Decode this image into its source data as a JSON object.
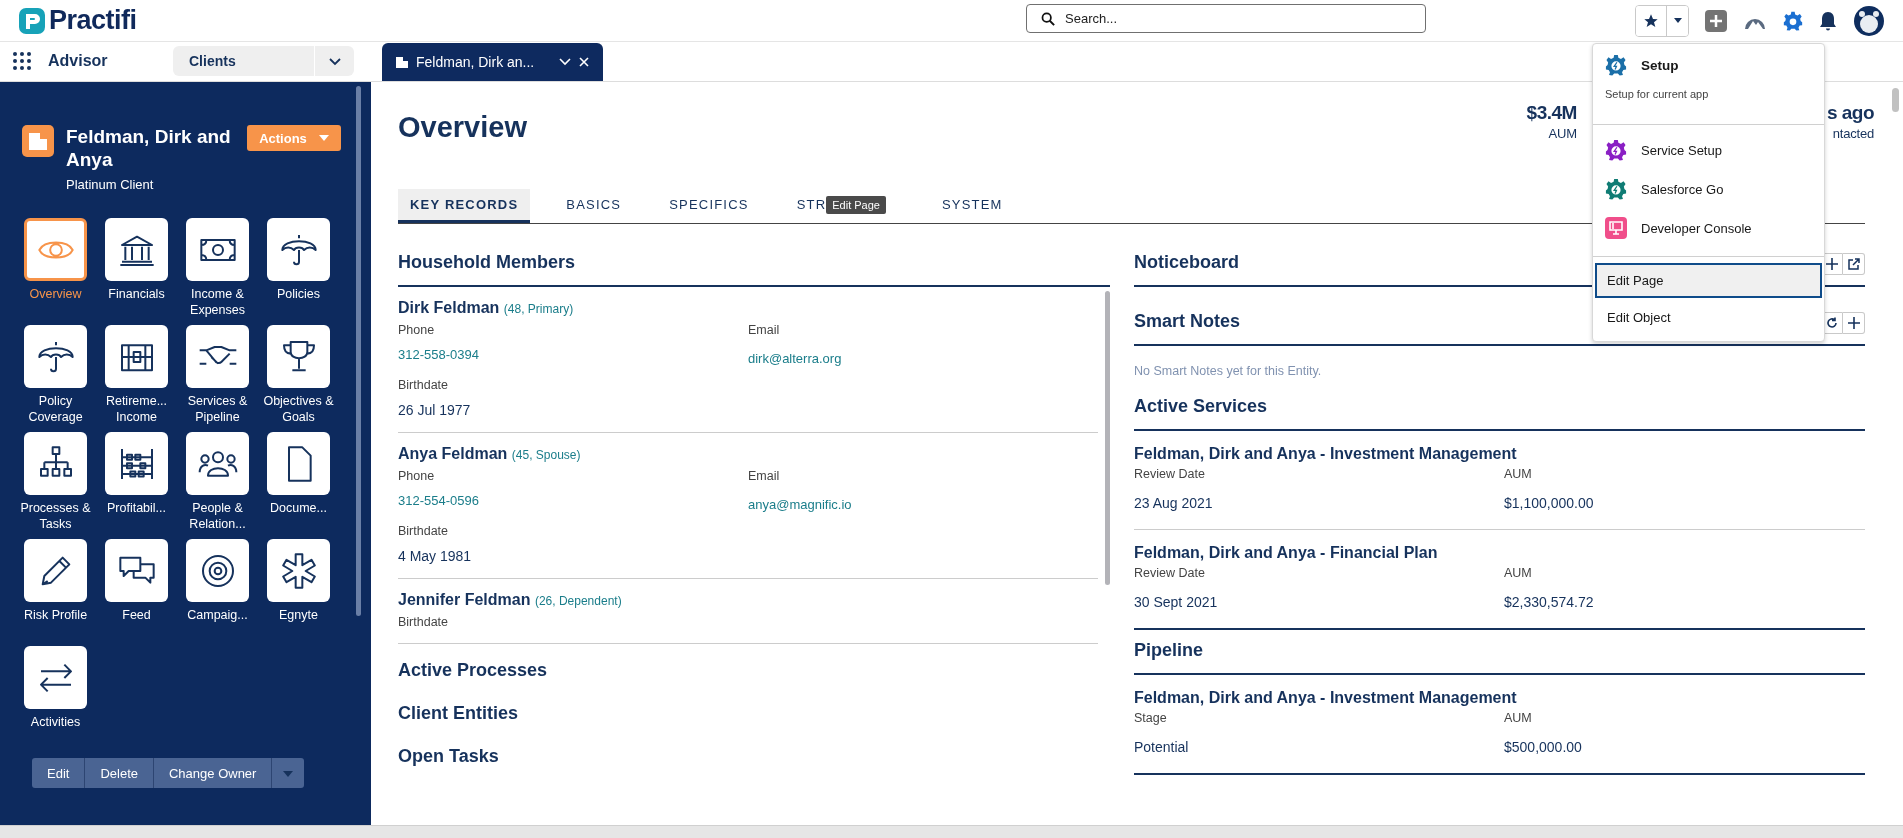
{
  "header": {
    "logo": "Practifi",
    "search": {
      "placeholder": "Search..."
    }
  },
  "nav": {
    "app": "Advisor",
    "object_menu": "Clients",
    "tabs": [
      {
        "label": "Feldman, Dirk an...",
        "selected": true
      }
    ]
  },
  "record": {
    "name": "Feldman, Dirk and Anya",
    "subtitle": "Platinum Client",
    "actions": "Actions"
  },
  "tiles": [
    {
      "label": "Overview",
      "selected": true
    },
    {
      "label": "Financials",
      "selected": false
    },
    {
      "label": "Income & Expenses",
      "selected": false
    },
    {
      "label": "Policies",
      "selected": false
    },
    {
      "label": "Policy Coverage",
      "selected": false
    },
    {
      "label": "Retireme... Income",
      "selected": false
    },
    {
      "label": "Services & Pipeline",
      "selected": false
    },
    {
      "label": "Objectives & Goals",
      "selected": false
    },
    {
      "label": "Processes & Tasks",
      "selected": false
    },
    {
      "label": "Profitabil...",
      "selected": false
    },
    {
      "label": "People & Relation...",
      "selected": false
    },
    {
      "label": "Docume...",
      "selected": false
    },
    {
      "label": "Risk Profile",
      "selected": false
    },
    {
      "label": "Feed",
      "selected": false
    },
    {
      "label": "Campaig...",
      "selected": false
    },
    {
      "label": "Egnyte",
      "selected": false
    },
    {
      "label": "Activities",
      "selected": false
    }
  ],
  "record_buttons": [
    "Edit",
    "Delete",
    "Change Owner"
  ],
  "page": {
    "title": "Overview",
    "stat_left": {
      "value": "$3.4M",
      "label": "AUM"
    },
    "stat_right": {
      "value": "s ago",
      "label": "ntacted"
    }
  },
  "section_tabs": [
    {
      "label": "KEY RECORDS",
      "selected": true
    },
    {
      "label": "BASICS",
      "selected": false
    },
    {
      "label": "SPECIFICS",
      "selected": false
    },
    {
      "label": "STR",
      "selected": false,
      "tooltip": "Edit Page"
    },
    {
      "label": "SYSTEM",
      "selected": false
    }
  ],
  "household": {
    "title": "Household Members",
    "members": [
      {
        "name": "Dirk Feldman",
        "detail": "(48, Primary)",
        "phone_label": "Phone",
        "phone": "312-558-0394",
        "email_label": "Email",
        "email": "dirk@alterra.org",
        "birthdate_label": "Birthdate",
        "birthdate": "26 Jul 1977"
      },
      {
        "name": "Anya Feldman",
        "detail": "(45, Spouse)",
        "phone_label": "Phone",
        "phone": "312-554-0596",
        "email_label": "Email",
        "email": "anya@magnific.io",
        "birthdate_label": "Birthdate",
        "birthdate": "4 May 1981"
      },
      {
        "name": "Jennifer Feldman",
        "detail": "(26, Dependent)",
        "birthdate_label": "Birthdate"
      }
    ]
  },
  "left_sections": [
    "Active Processes",
    "Client Entities",
    "Open Tasks"
  ],
  "noticeboard": {
    "title": "Noticeboard"
  },
  "smart_notes": {
    "title": "Smart Notes",
    "empty": "No Smart Notes yet for this Entity."
  },
  "active_services": {
    "title": "Active Services",
    "items": [
      {
        "name": "Feldman, Dirk and Anya - Investment Management",
        "fields": [
          {
            "label": "Review Date",
            "value": "23 Aug 2021"
          },
          {
            "label": "AUM",
            "value": "$1,100,000.00"
          }
        ]
      },
      {
        "name": "Feldman, Dirk and Anya - Financial Plan",
        "fields": [
          {
            "label": "Review Date",
            "value": "30 Sept 2021"
          },
          {
            "label": "AUM",
            "value": "$2,330,574.72"
          }
        ]
      }
    ]
  },
  "pipeline": {
    "title": "Pipeline",
    "items": [
      {
        "name": "Feldman, Dirk and Anya - Investment Management",
        "fields": [
          {
            "label": "Stage",
            "value": "Potential"
          },
          {
            "label": "AUM",
            "value": "$500,000.00"
          }
        ]
      }
    ]
  },
  "setup_menu": {
    "groups": [
      {
        "items": [
          {
            "kind": "header",
            "label": "Setup",
            "description": "Setup for current app",
            "color": "#1b6fa8"
          }
        ]
      },
      {
        "items": [
          {
            "kind": "gear",
            "label": "Service Setup",
            "color": "#8a1fc4"
          },
          {
            "kind": "gear",
            "label": "Salesforce Go",
            "color": "#0f7c74"
          },
          {
            "kind": "console",
            "label": "Developer Console",
            "color": "#f04e8a"
          }
        ]
      },
      {
        "items": [
          {
            "kind": "action",
            "label": "Edit Page",
            "selected": true
          },
          {
            "kind": "action",
            "label": "Edit Object",
            "selected": false
          }
        ]
      }
    ]
  }
}
